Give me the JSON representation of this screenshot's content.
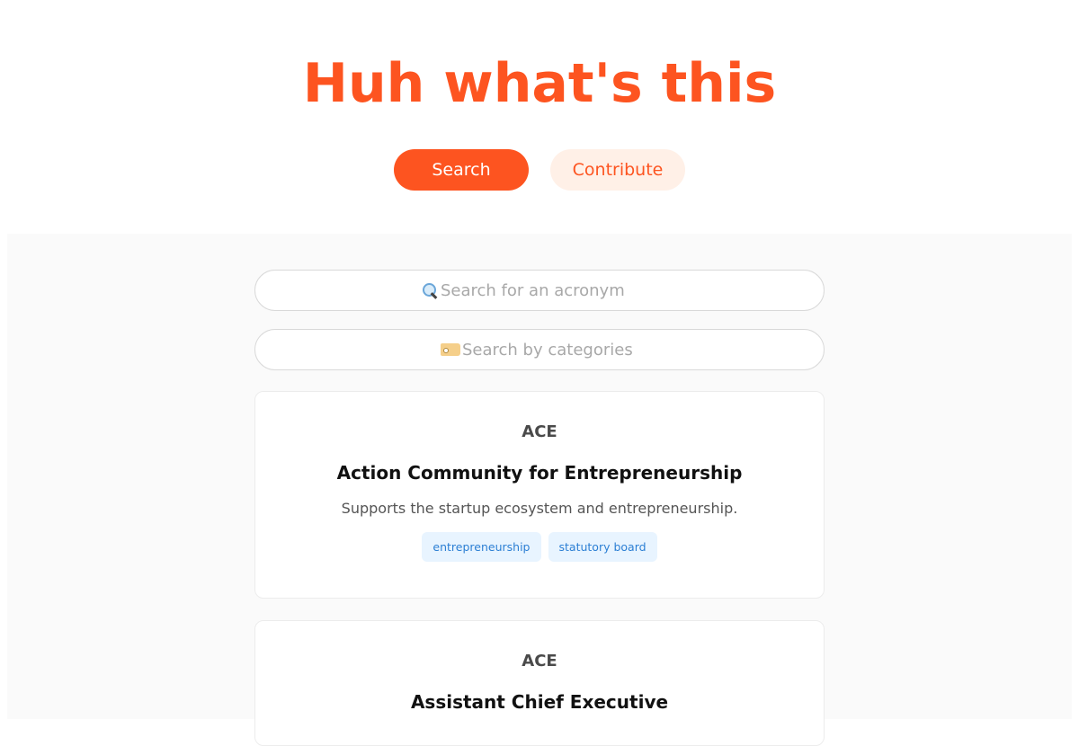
{
  "header": {
    "title": "Huh what's this",
    "nav": {
      "search_label": "Search",
      "contribute_label": "Contribute"
    }
  },
  "search": {
    "acronym_placeholder": "Search for an acronym",
    "acronym_icon": "magnifying-glass-icon",
    "category_placeholder": "Search by categories",
    "category_icon": "label-tag-icon"
  },
  "results": [
    {
      "acronym": "ACE",
      "full_name": "Action Community for Entrepreneurship",
      "description": "Supports the startup ecosystem and entrepreneurship.",
      "tags": [
        "entrepreneurship",
        "statutory board"
      ]
    },
    {
      "acronym": "ACE",
      "full_name": "Assistant Chief Executive"
    }
  ],
  "colors": {
    "accent": "#fd5420",
    "accent_light": "#fff0e7",
    "tag_bg": "#e8f4ff",
    "tag_text": "#2c7fd4",
    "panel_bg": "#fafafa"
  }
}
